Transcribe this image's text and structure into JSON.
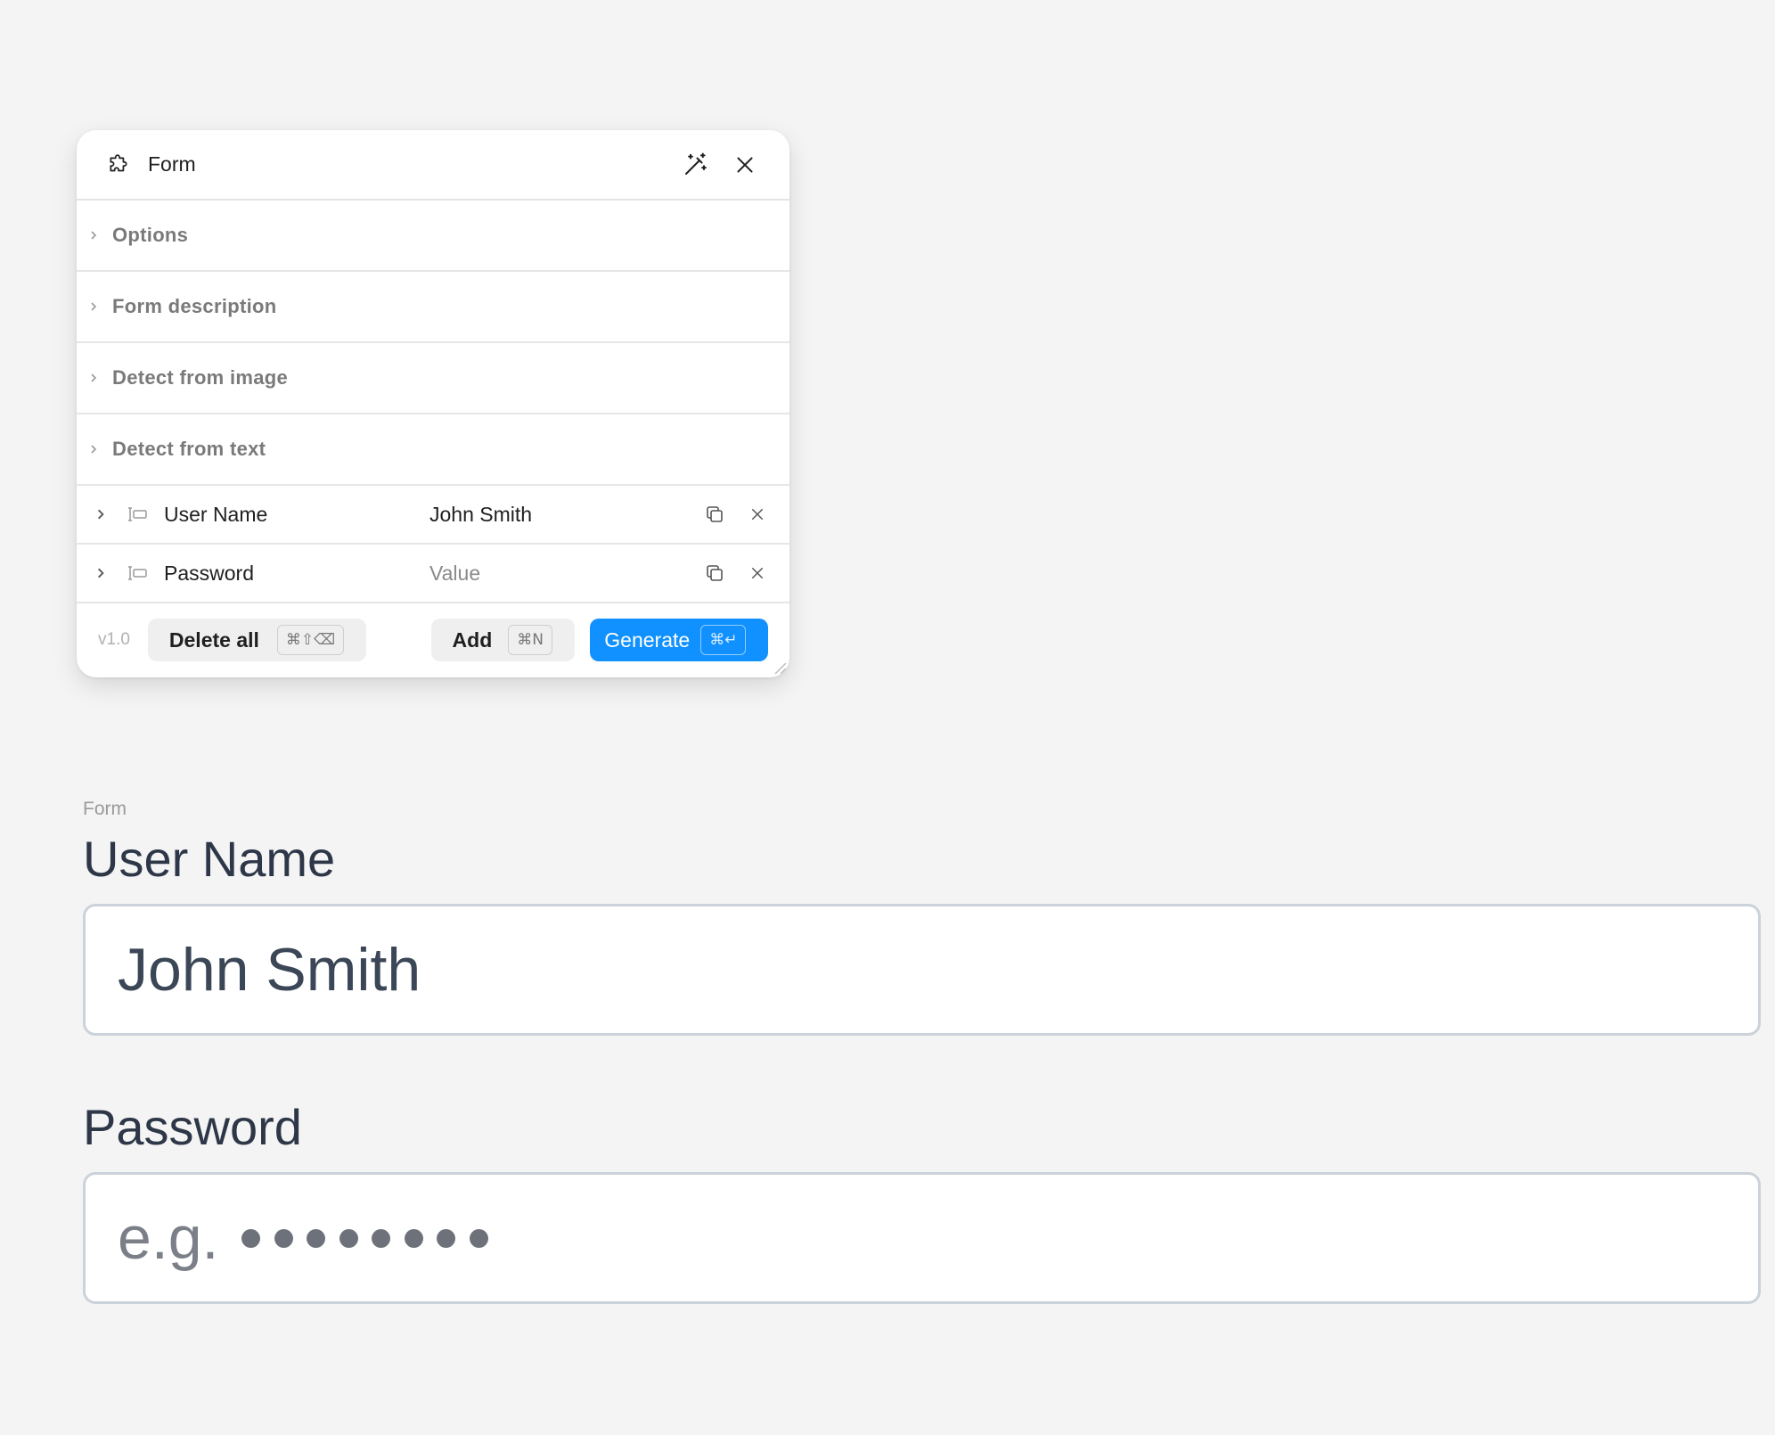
{
  "panel": {
    "title": "Form",
    "sections": [
      {
        "label": "Options"
      },
      {
        "label": "Form description"
      },
      {
        "label": "Detect from image"
      },
      {
        "label": "Detect from text"
      }
    ],
    "fields": [
      {
        "name": "User Name",
        "value": "John Smith",
        "value_is_placeholder": false
      },
      {
        "name": "Password",
        "value": "Value",
        "value_is_placeholder": true
      }
    ],
    "footer": {
      "version": "v1.0",
      "delete_all_label": "Delete all",
      "delete_all_shortcut": "⌘⇧⌫",
      "add_label": "Add",
      "add_shortcut": "⌘N",
      "generate_label": "Generate",
      "generate_shortcut": "⌘↵"
    },
    "icons": {
      "header": "puzzle-icon",
      "magic": "magic-wand-icon",
      "close": "close-icon",
      "field_type": "text-field-icon",
      "copy": "copy-icon",
      "remove": "close-icon"
    },
    "accent_color": "#1091ff"
  },
  "form": {
    "caption": "Form",
    "fields": [
      {
        "label": "User Name",
        "value": "John Smith"
      },
      {
        "label": "Password",
        "placeholder": "e.g.",
        "masked_dot_count": 8
      }
    ]
  }
}
